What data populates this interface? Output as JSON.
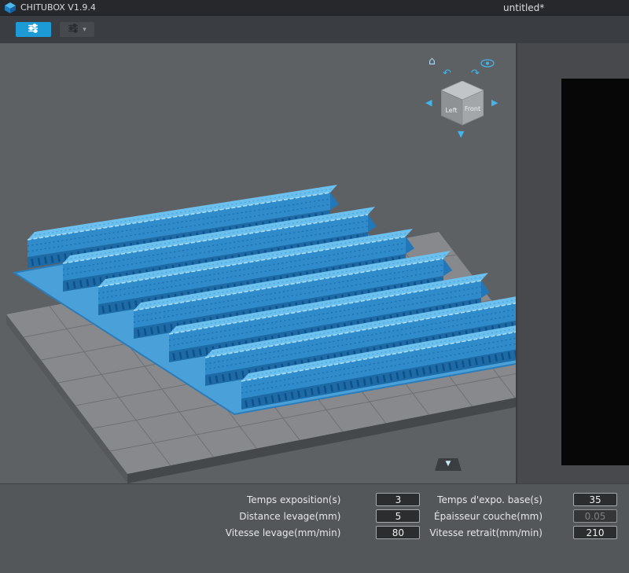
{
  "title_bar": {
    "app_title": "CHITUBOX V1.9.4",
    "document_title": "untitled*"
  },
  "toolbar": {
    "dropdown_chevron": "▾"
  },
  "viewport": {
    "nav_cube": {
      "left": "Left",
      "front": "Front"
    },
    "icons": {
      "home": "⌂",
      "rotate_left": "↶",
      "rotate_right": "↷",
      "arrow_left": "◀",
      "arrow_right": "▶",
      "arrow_down": "▼",
      "collapse": "▼"
    }
  },
  "settings_panel": {
    "fields": [
      {
        "label": "Temps exposition(s)",
        "value": "3",
        "disabled": false
      },
      {
        "label": "Temps d'expo. base(s)",
        "value": "35",
        "disabled": false
      },
      {
        "label": "Distance levage(mm)",
        "value": "5",
        "disabled": false
      },
      {
        "label": "Épaisseur couche(mm)",
        "value": "0.05",
        "disabled": true
      },
      {
        "label": "Vitesse levage(mm/min)",
        "value": "80",
        "disabled": false
      },
      {
        "label": "Vitesse retrait(mm/min)",
        "value": "210",
        "disabled": false
      }
    ]
  },
  "colors": {
    "accent_blue": "#1d9bd7",
    "model_blue": "#2f8bca",
    "plate_gray": "#87898c"
  }
}
